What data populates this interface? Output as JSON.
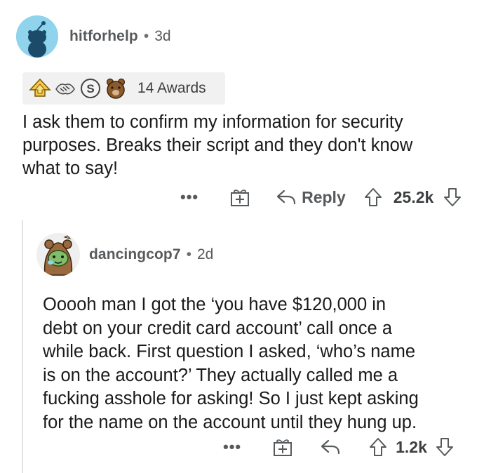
{
  "comment1": {
    "username": "hitforhelp",
    "separator": "•",
    "age": "3d",
    "awards": {
      "icons": [
        "gold-arrows-award-icon",
        "handshake-award-icon",
        "silver-award-icon",
        "bear-award-icon"
      ],
      "count_label": "14 Awards"
    },
    "body_lines": [
      "I ask them to confirm my information for security",
      "purposes. Breaks their script and they don't know",
      "what to say!"
    ],
    "actions": {
      "more": "•••",
      "reply_label": "Reply",
      "score": "25.2k"
    }
  },
  "comment2": {
    "username": "dancingcop7",
    "separator": "•",
    "age": "2d",
    "body_lines": [
      "Ooooh man I got the ‘you have $120,000 in",
      "debt on your credit card account’ call once a",
      "while back. First question I asked, ‘who’s name",
      "is on the account?’ They actually called me a",
      "fucking asshole for asking! So I just kept asking",
      "for the name on the account until they hung up."
    ],
    "actions": {
      "more": "•••",
      "score": "1.2k"
    }
  },
  "colors": {
    "text": "#1a1a1b",
    "meta": "#575a5c",
    "avatar1_bg": "#8fd3ec",
    "awards_bg": "#f1f1f1",
    "thread_line": "#e4e4e4"
  }
}
